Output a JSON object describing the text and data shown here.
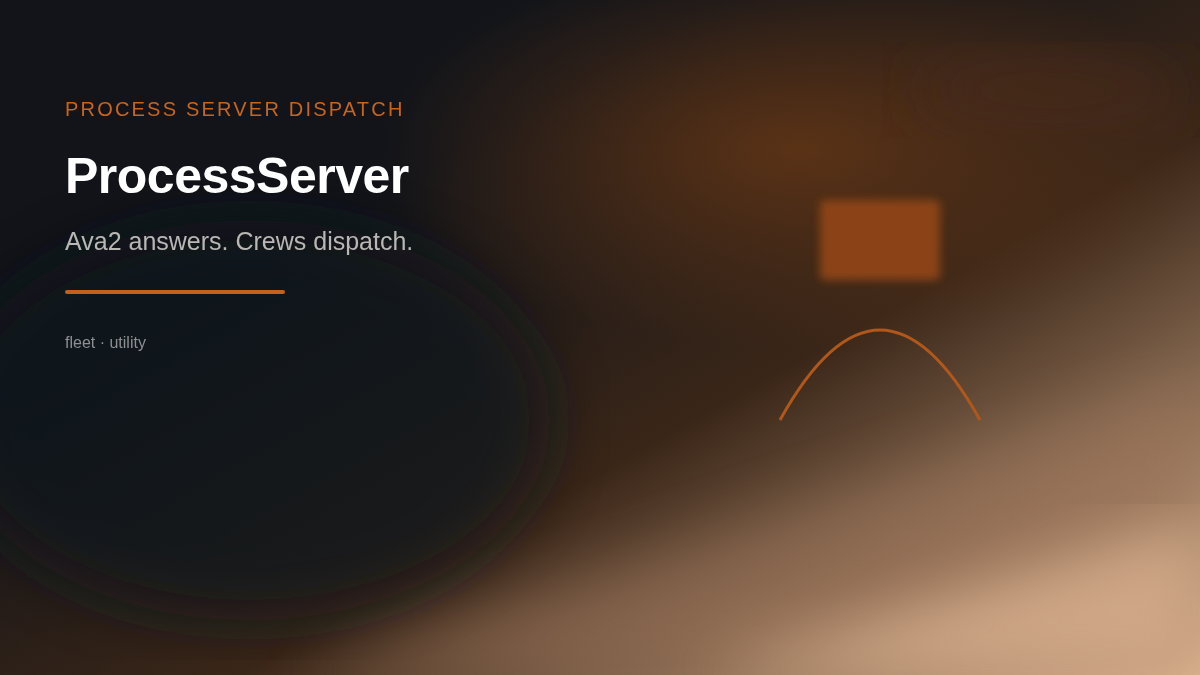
{
  "hero": {
    "eyebrow": "PROCESS SERVER DISPATCH",
    "title": "ProcessServer",
    "tagline": "Ava2 answers. Crews dispatch.",
    "meta": "fleet · utility"
  }
}
